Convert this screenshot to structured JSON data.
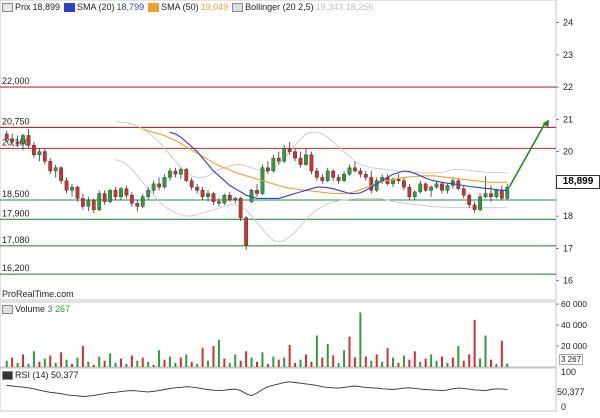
{
  "price_legend": {
    "prix_label": "Prix",
    "prix_value": "18,899",
    "sma20_label": "SMA (20)",
    "sma20_value": "18,799",
    "sma50_label": "SMA (50)",
    "sma50_value": "19,049",
    "boll_label": "Bollinger (20 2,5)",
    "boll_value": "19,343 18,256"
  },
  "last_price_tag": "18,899",
  "watermark": "ProRealTime.com",
  "volume_legend": {
    "label": "Volume",
    "value": "3 267"
  },
  "volume_last_tag": "3 267",
  "rsi_legend": {
    "label": "RSI (14)",
    "value": "50,377"
  },
  "rsi_last_tag": "50,377",
  "colors": {
    "up": "#2a9f3a",
    "down": "#d03030",
    "sma20": "#2f3fd0",
    "sma50": "#f0a030",
    "bollinger": "#c8c8c8",
    "resistance": "#c82828",
    "support": "#2a9040",
    "arrow": "#1f8a1f"
  },
  "chart_data": [
    {
      "type": "candlestick",
      "name": "price",
      "ylim": [
        15.4,
        24.7
      ],
      "y_ticks": [
        "24",
        "23",
        "22",
        "21",
        "20",
        "19",
        "18",
        "17",
        "16"
      ],
      "levels": [
        {
          "label": "22,000",
          "value": 22.0,
          "kind": "resistance"
        },
        {
          "label": "20,750",
          "value": 20.75,
          "kind": "resistance"
        },
        {
          "label": "20,100",
          "value": 20.1,
          "kind": "resistance"
        },
        {
          "label": "18,500",
          "value": 18.5,
          "kind": "support"
        },
        {
          "label": "17,900",
          "value": 17.9,
          "kind": "support"
        },
        {
          "label": "17,080",
          "value": 17.08,
          "kind": "support"
        },
        {
          "label": "16,200",
          "value": 16.2,
          "kind": "support"
        }
      ],
      "candles": [
        [
          20.55,
          20.65,
          20.3,
          20.4
        ],
        [
          20.4,
          20.55,
          20.2,
          20.3
        ],
        [
          20.3,
          20.5,
          20.15,
          20.25
        ],
        [
          20.25,
          20.55,
          20.05,
          20.5
        ],
        [
          20.5,
          20.7,
          20.1,
          20.2
        ],
        [
          20.2,
          20.3,
          19.8,
          19.9
        ],
        [
          19.9,
          20.1,
          19.7,
          20.0
        ],
        [
          20.0,
          20.1,
          19.6,
          19.7
        ],
        [
          19.7,
          19.8,
          19.3,
          19.4
        ],
        [
          19.4,
          19.6,
          19.2,
          19.5
        ],
        [
          19.5,
          19.55,
          19.0,
          19.1
        ],
        [
          19.1,
          19.2,
          18.7,
          18.8
        ],
        [
          18.8,
          19.0,
          18.6,
          18.9
        ],
        [
          18.9,
          18.95,
          18.45,
          18.55
        ],
        [
          18.55,
          18.7,
          18.2,
          18.3
        ],
        [
          18.3,
          18.6,
          18.15,
          18.5
        ],
        [
          18.5,
          18.55,
          18.1,
          18.2
        ],
        [
          18.2,
          18.8,
          18.15,
          18.7
        ],
        [
          18.7,
          18.8,
          18.35,
          18.45
        ],
        [
          18.45,
          18.85,
          18.4,
          18.8
        ],
        [
          18.8,
          18.9,
          18.5,
          18.6
        ],
        [
          18.6,
          18.9,
          18.5,
          18.85
        ],
        [
          18.85,
          18.95,
          18.55,
          18.65
        ],
        [
          18.65,
          18.75,
          18.3,
          18.4
        ],
        [
          18.4,
          18.5,
          18.15,
          18.3
        ],
        [
          18.3,
          18.7,
          18.25,
          18.6
        ],
        [
          18.6,
          18.9,
          18.5,
          18.8
        ],
        [
          18.8,
          19.1,
          18.7,
          19.0
        ],
        [
          19.0,
          19.2,
          18.8,
          18.9
        ],
        [
          18.9,
          19.3,
          18.85,
          19.2
        ],
        [
          19.2,
          19.5,
          19.1,
          19.4
        ],
        [
          19.4,
          19.5,
          19.2,
          19.3
        ],
        [
          19.3,
          19.5,
          19.15,
          19.45
        ],
        [
          19.45,
          19.5,
          19.05,
          19.1
        ],
        [
          19.1,
          19.2,
          18.8,
          18.9
        ],
        [
          18.9,
          19.0,
          18.7,
          18.8
        ],
        [
          18.8,
          18.9,
          18.5,
          18.6
        ],
        [
          18.6,
          18.8,
          18.45,
          18.7
        ],
        [
          18.7,
          18.75,
          18.35,
          18.45
        ],
        [
          18.45,
          18.55,
          18.3,
          18.4
        ],
        [
          18.4,
          18.7,
          18.35,
          18.65
        ],
        [
          18.65,
          18.75,
          18.45,
          18.5
        ],
        [
          18.5,
          18.6,
          18.4,
          18.55
        ],
        [
          18.55,
          18.6,
          17.85,
          17.95
        ],
        [
          17.95,
          18.0,
          16.95,
          17.1
        ],
        [
          18.45,
          18.85,
          18.4,
          18.8
        ],
        [
          18.8,
          19.0,
          18.6,
          18.7
        ],
        [
          18.7,
          19.6,
          18.65,
          19.5
        ],
        [
          19.5,
          19.7,
          19.3,
          19.4
        ],
        [
          19.4,
          19.9,
          19.35,
          19.8
        ],
        [
          19.8,
          20.0,
          19.6,
          19.7
        ],
        [
          19.7,
          20.2,
          19.65,
          20.1
        ],
        [
          20.1,
          20.3,
          19.9,
          20.0
        ],
        [
          20.0,
          20.1,
          19.7,
          19.8
        ],
        [
          19.8,
          20.0,
          19.5,
          19.6
        ],
        [
          19.6,
          20.1,
          19.55,
          19.9
        ],
        [
          19.9,
          20.0,
          19.3,
          19.4
        ],
        [
          19.4,
          19.5,
          19.1,
          19.2
        ],
        [
          19.2,
          19.3,
          19.0,
          19.1
        ],
        [
          19.1,
          19.5,
          19.05,
          19.4
        ],
        [
          19.4,
          19.45,
          19.1,
          19.2
        ],
        [
          19.2,
          19.3,
          19.0,
          19.1
        ],
        [
          19.1,
          19.4,
          19.05,
          19.3
        ],
        [
          19.3,
          19.6,
          19.25,
          19.5
        ],
        [
          19.5,
          19.7,
          19.35,
          19.4
        ],
        [
          19.4,
          19.5,
          19.2,
          19.3
        ],
        [
          19.3,
          19.4,
          19.1,
          19.2
        ],
        [
          19.2,
          19.4,
          18.7,
          18.8
        ],
        [
          18.8,
          19.2,
          18.75,
          19.1
        ],
        [
          19.1,
          19.3,
          19.0,
          19.2
        ],
        [
          19.2,
          19.3,
          18.95,
          19.0
        ],
        [
          19.0,
          19.2,
          18.9,
          19.15
        ],
        [
          19.15,
          19.3,
          19.0,
          19.1
        ],
        [
          19.1,
          19.2,
          18.8,
          18.9
        ],
        [
          18.9,
          19.0,
          18.5,
          18.6
        ],
        [
          18.6,
          18.8,
          18.5,
          18.75
        ],
        [
          18.75,
          19.1,
          18.7,
          19.0
        ],
        [
          19.0,
          19.05,
          18.75,
          18.8
        ],
        [
          18.8,
          18.95,
          18.6,
          18.9
        ],
        [
          18.9,
          19.1,
          18.85,
          19.0
        ],
        [
          19.0,
          19.05,
          18.7,
          18.8
        ],
        [
          18.8,
          19.0,
          18.7,
          18.95
        ],
        [
          18.95,
          19.2,
          18.85,
          19.1
        ],
        [
          19.1,
          19.15,
          18.8,
          18.85
        ],
        [
          18.85,
          18.95,
          18.55,
          18.65
        ],
        [
          18.65,
          18.7,
          18.25,
          18.35
        ],
        [
          18.35,
          18.45,
          18.1,
          18.2
        ],
        [
          18.2,
          18.7,
          18.15,
          18.6
        ],
        [
          18.6,
          19.25,
          18.55,
          18.7
        ],
        [
          18.7,
          18.95,
          18.45,
          18.6
        ],
        [
          18.6,
          18.85,
          18.55,
          18.8
        ],
        [
          18.8,
          18.95,
          18.5,
          18.55
        ],
        [
          18.55,
          19.0,
          18.5,
          18.9
        ]
      ],
      "sma20": [
        20.6,
        20.55,
        20.45,
        20.3,
        20.15,
        20.0,
        19.8,
        19.6,
        19.4,
        19.25,
        19.1,
        18.95,
        18.85,
        18.75,
        18.65,
        18.6,
        18.55,
        18.55,
        18.55,
        18.55,
        18.55,
        18.6,
        18.65,
        18.7,
        18.75,
        18.8,
        18.85,
        18.9,
        18.9,
        18.88,
        18.85,
        18.8,
        18.75,
        18.7,
        18.7,
        18.72,
        18.8,
        18.9,
        19.0,
        19.1,
        19.2,
        19.3,
        19.35,
        19.4,
        19.38,
        19.32,
        19.25,
        19.18,
        19.12,
        19.08,
        19.05,
        19.02,
        19.0,
        18.98,
        18.95,
        18.92,
        18.9,
        18.88,
        18.86,
        18.85,
        18.82,
        18.8,
        18.8
      ],
      "sma20_start": 30,
      "sma50": [
        20.7,
        20.65,
        20.6,
        20.55,
        20.5,
        20.42,
        20.35,
        20.25,
        20.15,
        20.05,
        19.95,
        19.85,
        19.75,
        19.65,
        19.57,
        19.5,
        19.43,
        19.36,
        19.3,
        19.25,
        19.2,
        19.15,
        19.1,
        19.05,
        19.0,
        18.95,
        18.9,
        18.87,
        18.84,
        18.82,
        18.8,
        18.78,
        18.76,
        18.74,
        18.72,
        18.7,
        18.7,
        18.7,
        18.72,
        18.76,
        18.82,
        18.88,
        18.94,
        19.0,
        19.06,
        19.1,
        19.14,
        19.17,
        19.2,
        19.22,
        19.23,
        19.24,
        19.25,
        19.25,
        19.24,
        19.22,
        19.2,
        19.18,
        19.16,
        19.14,
        19.12,
        19.1,
        19.08,
        19.06,
        19.05,
        19.05,
        19.05,
        19.05
      ],
      "sma50_start": 25,
      "boll_upper": [
        20.95,
        20.9,
        20.9,
        20.85,
        20.8,
        20.7,
        20.6,
        20.45,
        20.3,
        20.1,
        19.9,
        19.7,
        19.5,
        19.35,
        19.25,
        19.2,
        19.2,
        19.25,
        19.35,
        19.45,
        19.5,
        19.55,
        19.6,
        19.6,
        19.55,
        19.5,
        19.45,
        19.4,
        19.4,
        19.5,
        19.6,
        19.8,
        20.0,
        20.2,
        20.4,
        20.55,
        20.6,
        20.6,
        20.55,
        20.45,
        20.3,
        20.15,
        20.0,
        19.85,
        19.7,
        19.6,
        19.55,
        19.5,
        19.48,
        19.46,
        19.44,
        19.42,
        19.4,
        19.38,
        19.36,
        19.35,
        19.34,
        19.34,
        19.34,
        19.35,
        19.36,
        19.4,
        19.45,
        19.45,
        19.44,
        19.42,
        19.4,
        19.38,
        19.36,
        19.35,
        19.36,
        19.35,
        19.34
      ],
      "boll_lower": [
        19.75,
        19.7,
        19.6,
        19.45,
        19.25,
        19.05,
        18.85,
        18.65,
        18.45,
        18.3,
        18.2,
        18.1,
        18.05,
        18.0,
        18.0,
        18.05,
        18.1,
        18.15,
        18.2,
        18.25,
        18.3,
        18.35,
        18.35,
        18.3,
        18.2,
        18.0,
        17.8,
        17.6,
        17.4,
        17.25,
        17.2,
        17.25,
        17.35,
        17.5,
        17.7,
        17.9,
        18.05,
        18.2,
        18.3,
        18.38,
        18.44,
        18.48,
        18.5,
        18.52,
        18.54,
        18.55,
        18.56,
        18.56,
        18.55,
        18.53,
        18.5,
        18.45,
        18.42,
        18.4,
        18.38,
        18.36,
        18.34,
        18.32,
        18.3,
        18.29,
        18.28,
        18.27,
        18.27,
        18.26,
        18.26,
        18.26,
        18.26,
        18.26,
        18.26,
        18.26,
        18.26,
        18.26,
        18.26
      ],
      "projection": {
        "from": [
          18.9
        ],
        "to": [
          21.0
        ]
      }
    },
    {
      "type": "bar",
      "name": "volume",
      "ylim": [
        0,
        62000
      ],
      "y_ticks": [
        "60 000",
        "40 000",
        "20 000"
      ],
      "values": [
        6000,
        9000,
        4000,
        12000,
        3000,
        15000,
        5000,
        8000,
        11000,
        4000,
        14000,
        7000,
        3000,
        9000,
        20000,
        5000,
        2000,
        10000,
        6000,
        13000,
        4000,
        8000,
        3000,
        11000,
        6000,
        9000,
        5000,
        2000,
        16000,
        7000,
        10000,
        4000,
        9000,
        12000,
        5000,
        3000,
        18000,
        6000,
        20000,
        26000,
        8000,
        4000,
        12000,
        6000,
        15000,
        9000,
        5000,
        14000,
        3000,
        10000,
        7000,
        9000,
        21000,
        4000,
        7000,
        12000,
        5000,
        30000,
        9000,
        22000,
        11000,
        4000,
        16000,
        29000,
        9000,
        52000,
        10000,
        6000,
        12000,
        5000,
        18000,
        9000,
        4000,
        11000,
        7000,
        15000,
        5000,
        8000,
        12000,
        6000,
        10000,
        4000,
        9000,
        20000,
        6000,
        12000,
        45000,
        8000,
        30000,
        7000,
        3000,
        25000,
        3267
      ],
      "directions": [
        1,
        0,
        1,
        0,
        1,
        1,
        0,
        1,
        0,
        1,
        0,
        1,
        0,
        1,
        0,
        1,
        0,
        1,
        0,
        1,
        1,
        0,
        1,
        0,
        1,
        0,
        1,
        0,
        1,
        0,
        1,
        1,
        0,
        1,
        0,
        1,
        0,
        1,
        0,
        1,
        0,
        1,
        1,
        0,
        0,
        1,
        0,
        1,
        0,
        1,
        0,
        1,
        0,
        0,
        1,
        0,
        0,
        1,
        0,
        1,
        0,
        1,
        1,
        0,
        0,
        1,
        0,
        1,
        0,
        1,
        0,
        1,
        0,
        1,
        0,
        0,
        1,
        0,
        1,
        1,
        0,
        1,
        0,
        1,
        0,
        0,
        0,
        1,
        1,
        0,
        1,
        0,
        1
      ]
    },
    {
      "type": "line",
      "name": "rsi",
      "ylim": [
        0,
        100
      ],
      "y_ticks": [
        "100",
        "0"
      ],
      "values": [
        62,
        60,
        58,
        57,
        55,
        52,
        48,
        45,
        42,
        40,
        38,
        35,
        33,
        32,
        30,
        31,
        33,
        36,
        38,
        41,
        42,
        44,
        46,
        47,
        46,
        44,
        43,
        45,
        47,
        50,
        53,
        55,
        56,
        58,
        57,
        55,
        52,
        50,
        48,
        47,
        48,
        50,
        51,
        47,
        38,
        32,
        40,
        50,
        58,
        62,
        66,
        70,
        72,
        70,
        68,
        66,
        64,
        61,
        58,
        56,
        55,
        54,
        56,
        58,
        60,
        58,
        56,
        55,
        54,
        52,
        51,
        50,
        52,
        54,
        55,
        53,
        51,
        50,
        49,
        48,
        47,
        49,
        52,
        54,
        53,
        51,
        49,
        48,
        47,
        50,
        52,
        51,
        50.4
      ]
    }
  ]
}
